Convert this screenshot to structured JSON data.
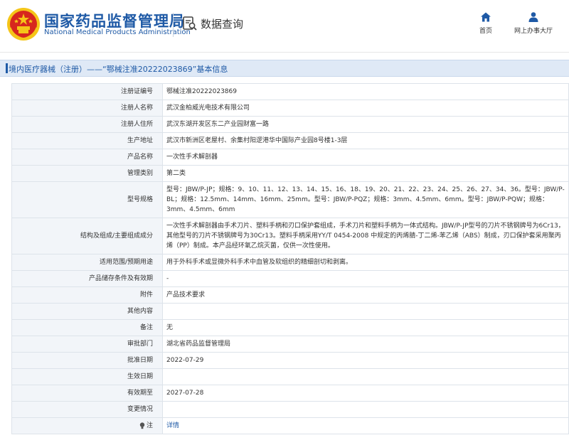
{
  "header": {
    "site_name": "国家药品监督管理局",
    "site_name_en": "National Medical Products Administration",
    "query_label": "数据查询",
    "nav_home": "首页",
    "nav_hall": "网上办事大厅"
  },
  "title": "境内医疗器械（注册）——“鄂械注准20222023869”基本信息",
  "rows": [
    {
      "label": "注册证编号",
      "value": "鄂械注准20222023869"
    },
    {
      "label": "注册人名称",
      "value": "武汉金柏威光电技术有限公司"
    },
    {
      "label": "注册人住所",
      "value": "武汉东湖开发区东二产业园财富一路"
    },
    {
      "label": "生产地址",
      "value": "武汉市新洲区老屋村、余集村阳逻港华中国际产业园8号楼1-3层"
    },
    {
      "label": "产品名称",
      "value": "一次性手术解剖器"
    },
    {
      "label": "管理类别",
      "value": "第二类"
    },
    {
      "label": "型号规格",
      "value": "型号：JBW/P-JP；规格：9、10、11、12、13、14、15、16、18、19、20、21、22、23、24、25、26、27、34、36。型号：JBW/P-BL；规格：12.5mm、14mm、16mm、25mm。型号：JBW/P-PQZ；规格：3mm、4.5mm、6mm。型号：JBW/P-PQW；规格：3mm、4.5mm、6mm"
    },
    {
      "label": "结构及组成/主要组成成分",
      "value": "一次性手术解剖器由手术刀片、塑料手柄和刃口保护套组成，手术刀片和塑料手柄为一体式结构。JBW/P-JP型号的刀片不锈钢牌号为6Cr13，其他型号的刀片不锈钢牌号为30Cr13。塑料手柄采用YY/T 0454-2008 中规定的丙烯腈-丁二烯-苯乙烯（ABS）制成，刃口保护套采用聚丙烯（PP）制成。本产品经环氧乙烷灭菌，仅供一次性使用。"
    },
    {
      "label": "适用范围/预期用途",
      "value": "用于外科手术或显微外科手术中血管及软组织的精细剖切和剥离。"
    },
    {
      "label": "产品储存条件及有效期",
      "value": "-"
    },
    {
      "label": "附件",
      "value": "产品技术要求"
    },
    {
      "label": "其他内容",
      "value": ""
    },
    {
      "label": "备注",
      "value": "无"
    },
    {
      "label": "审批部门",
      "value": "湖北省药品监督管理局"
    },
    {
      "label": "批准日期",
      "value": "2022-07-29"
    },
    {
      "label": "生效日期",
      "value": ""
    },
    {
      "label": "有效期至",
      "value": "2027-07-28"
    },
    {
      "label": "变更情况",
      "value": ""
    }
  ],
  "note_row": {
    "label": "注",
    "link": "详情"
  },
  "colors": {
    "brand_blue": "#1f5aa6",
    "label_bg": "#f2f5f9",
    "title_bar_bg": "#dfe9f6",
    "emblem_red": "#d7261e",
    "emblem_gold": "#f5c518"
  },
  "icons": {
    "logo": "national-emblem-icon",
    "query": "search-document-icon",
    "home": "home-icon",
    "hall": "user-icon",
    "note": "lightbulb-icon"
  }
}
